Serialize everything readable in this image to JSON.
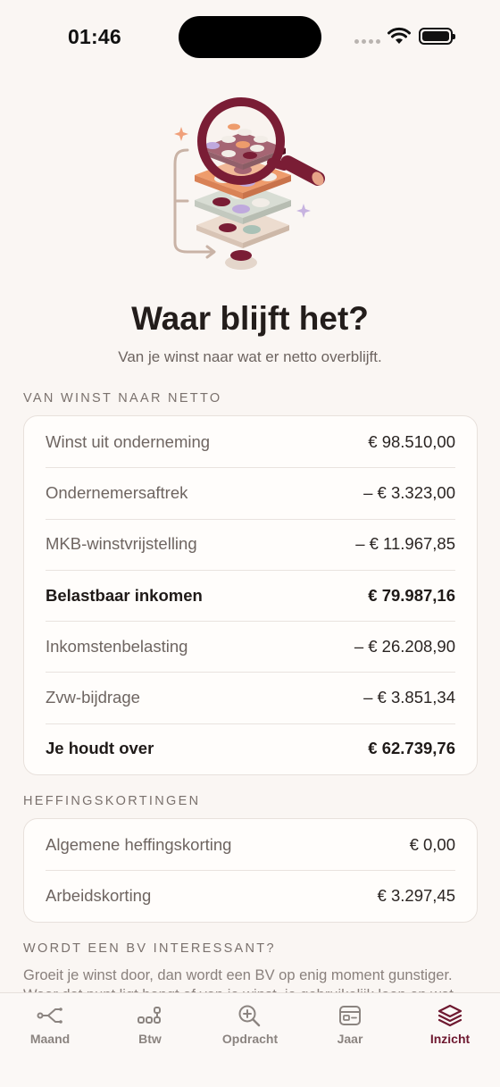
{
  "status": {
    "time": "01:46"
  },
  "header": {
    "title": "Waar blijft het?",
    "subtitle": "Van je winst naar wat er netto overblijft."
  },
  "net_section": {
    "label": "VAN WINST NAAR NETTO",
    "rows": [
      {
        "label": "Winst uit onderneming",
        "value": "€ 98.510,00"
      },
      {
        "label": "Ondernemersaftrek",
        "value": "– € 3.323,00"
      },
      {
        "label": "MKB-winstvrijstelling",
        "value": "– € 11.967,85"
      },
      {
        "label": "Belastbaar inkomen",
        "value": "€ 79.987,16"
      },
      {
        "label": "Inkomstenbelasting",
        "value": "– € 26.208,90"
      },
      {
        "label": "Zvw-bijdrage",
        "value": "– € 3.851,34"
      },
      {
        "label": "Je houdt over",
        "value": "€ 62.739,76"
      }
    ]
  },
  "credits_section": {
    "label": "HEFFINGSKORTINGEN",
    "rows": [
      {
        "label": "Algemene heffingskorting",
        "value": "€ 0,00"
      },
      {
        "label": "Arbeidskorting",
        "value": "€ 3.297,45"
      }
    ]
  },
  "bv_section": {
    "label": "WORDT EEN BV INTERESSANT?",
    "text": "Groeit je winst door, dan wordt een BV op enig moment gunstiger. Waar dat punt ligt hangt af van je winst, je gebruikelijk loon en wat"
  },
  "tabbar": {
    "tabs": [
      {
        "label": "Maand",
        "icon": "branch-icon"
      },
      {
        "label": "Btw",
        "icon": "dots-icon"
      },
      {
        "label": "Opdracht",
        "icon": "zoom-in-icon"
      },
      {
        "label": "Jaar",
        "icon": "card-icon"
      },
      {
        "label": "Inzicht",
        "icon": "layers-icon"
      }
    ],
    "active": "Inzicht"
  },
  "colors": {
    "accent": "#6e1930",
    "background": "#faf6f3",
    "inactive_tab": "#8b8480"
  }
}
